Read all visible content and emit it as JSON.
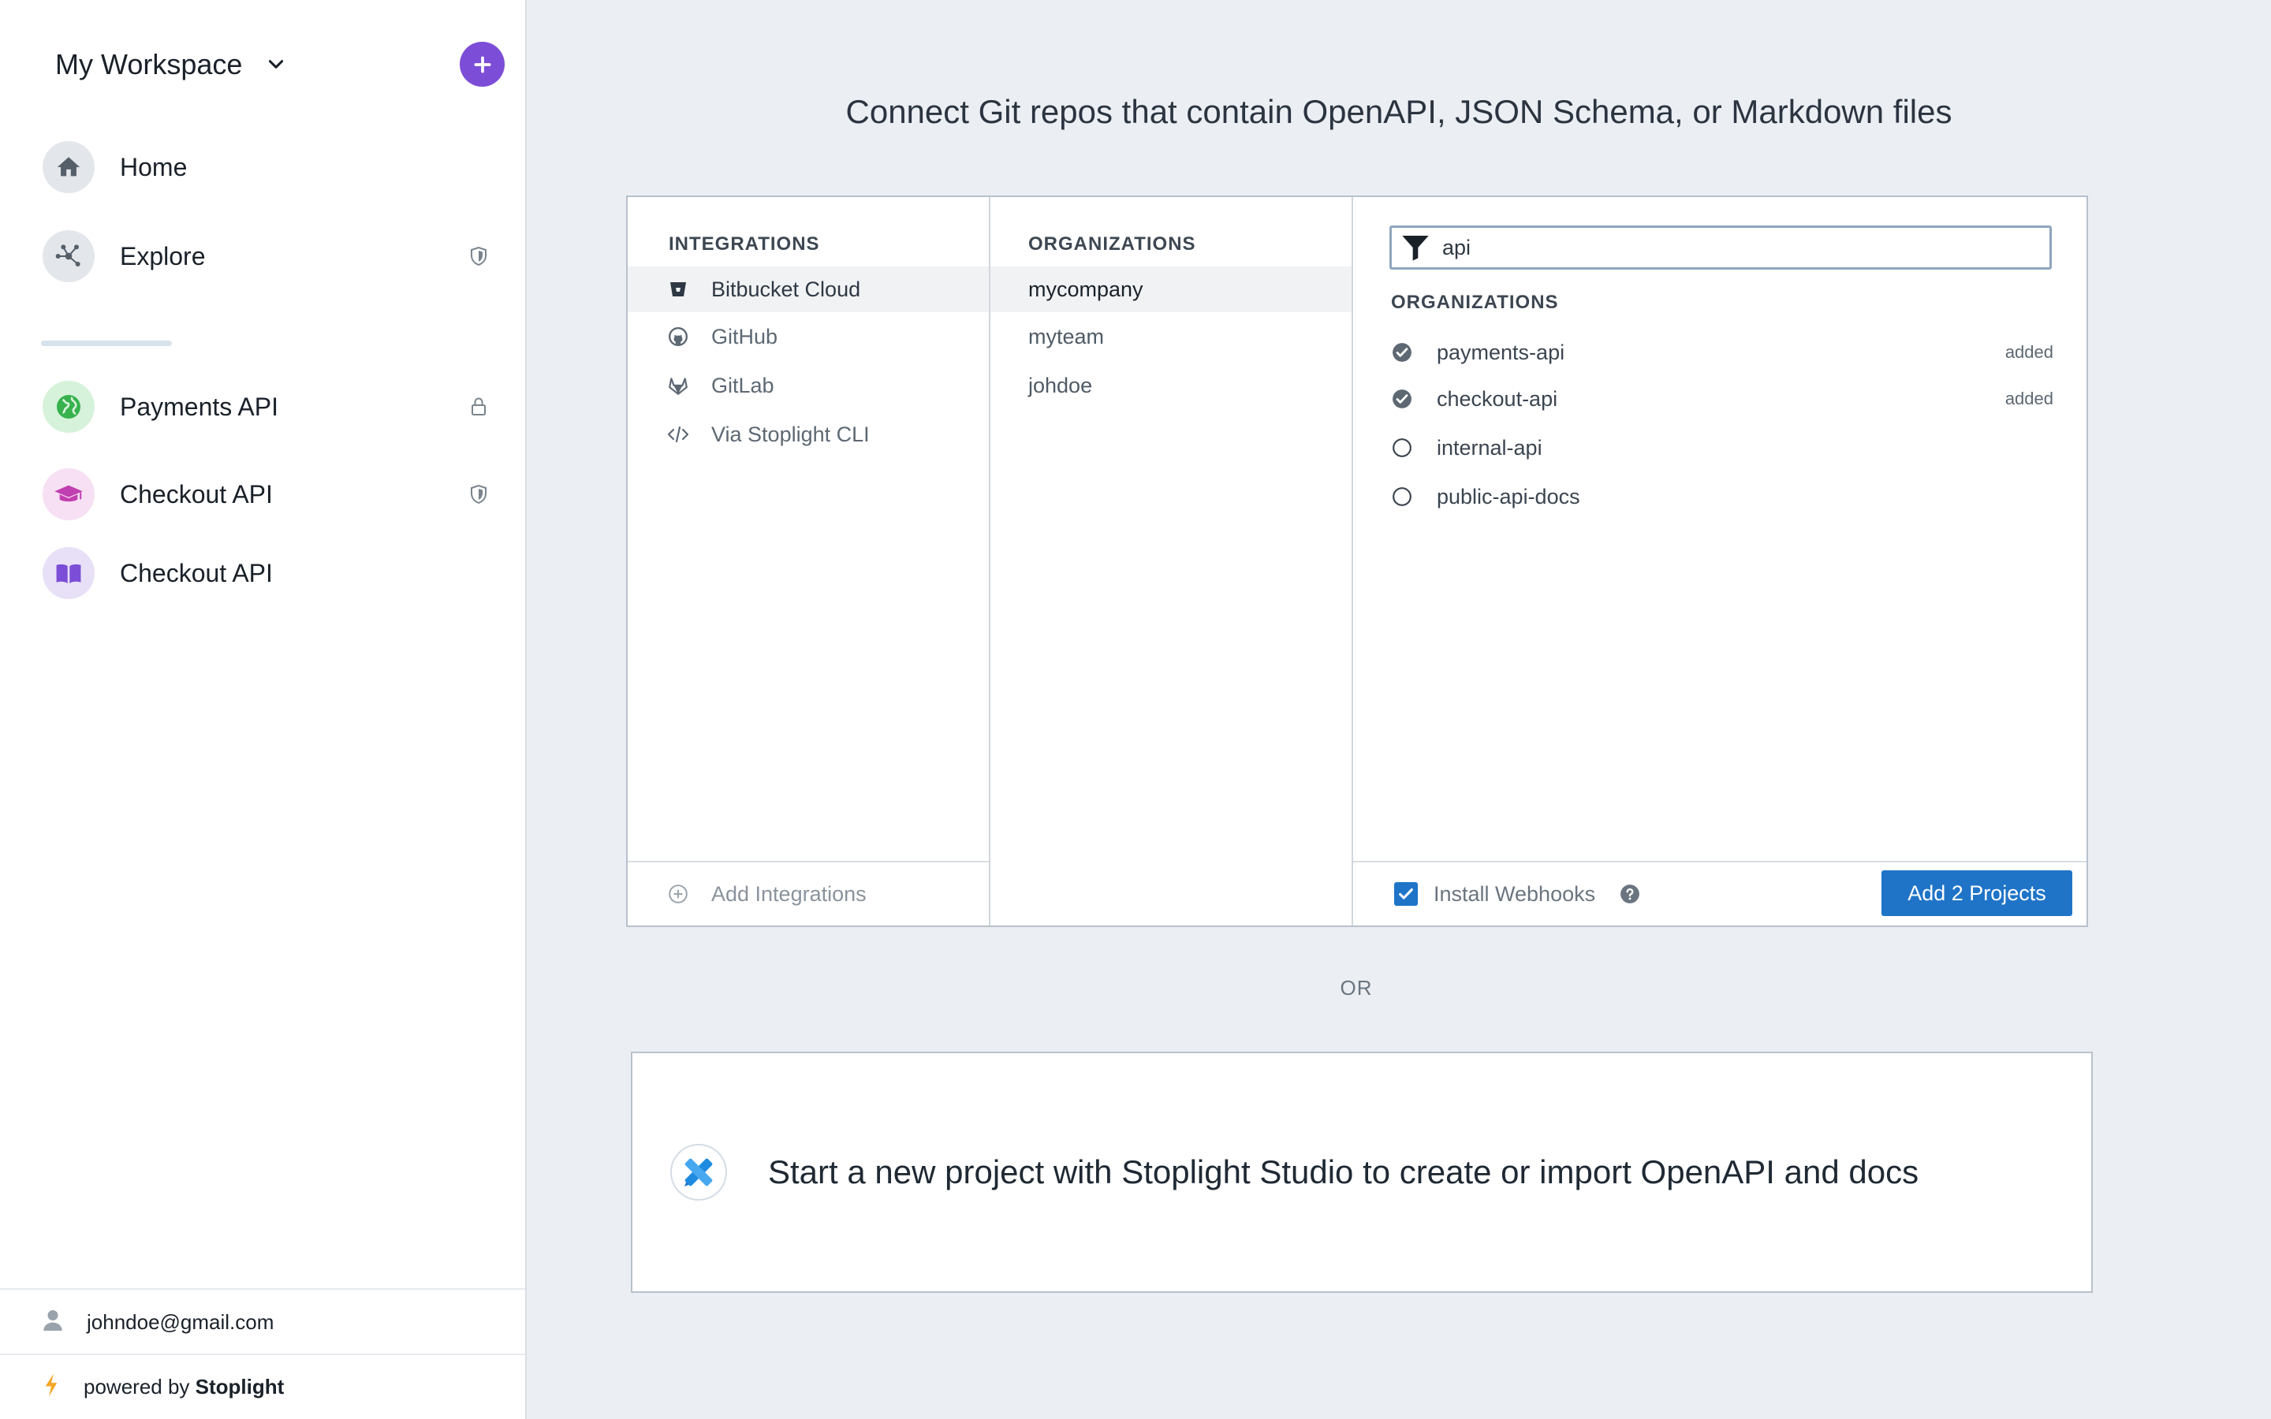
{
  "sidebar": {
    "workspace_title": "My Workspace",
    "nav": [
      {
        "label": "Home",
        "icon": "home-icon",
        "color": "#dfe3e7"
      },
      {
        "label": "Explore",
        "icon": "network-icon",
        "color": "#dfe3e7"
      },
      {
        "label": "Payments API",
        "icon": "globe-icon",
        "color": "#d4f1d8"
      },
      {
        "label": "Checkout API",
        "icon": "graduation-cap-icon",
        "color": "#f6dff1"
      },
      {
        "label": "Checkout API",
        "icon": "book-icon",
        "color": "#e6ddf6"
      }
    ],
    "user_email": "johndoe@gmail.com",
    "powered_prefix": "powered by",
    "powered_brand": "Stoplight"
  },
  "main": {
    "title": "Connect Git repos that contain OpenAPI, JSON Schema, or Markdown files",
    "integrations": {
      "heading": "INTEGRATIONS",
      "items": [
        "Bitbucket Cloud",
        "GitHub",
        "GitLab",
        "Via Stoplight CLI"
      ],
      "selected": "Bitbucket Cloud",
      "add_label": "Add Integrations"
    },
    "organizations": {
      "heading": "ORGANIZATIONS",
      "items": [
        "mycompany",
        "myteam",
        "johdoe"
      ],
      "selected": "mycompany"
    },
    "repos": {
      "search_value": "api",
      "heading": "ORGANIZATIONS",
      "items": [
        {
          "name": "payments-api",
          "checked": true,
          "status": "added"
        },
        {
          "name": "checkout-api",
          "checked": true,
          "status": "added"
        },
        {
          "name": "internal-api",
          "checked": false,
          "status": ""
        },
        {
          "name": "public-api-docs",
          "checked": false,
          "status": ""
        }
      ],
      "webhook_label": "Install Webhooks",
      "webhook_checked": true,
      "add_button": "Add 2 Projects"
    },
    "or_text": "OR",
    "studio_text": "Start a new project with Stoplight Studio to create or import OpenAPI and docs"
  },
  "colors": {
    "accent": "#1f74c8",
    "purple": "#7c4dd6",
    "background": "#ebeff3"
  }
}
